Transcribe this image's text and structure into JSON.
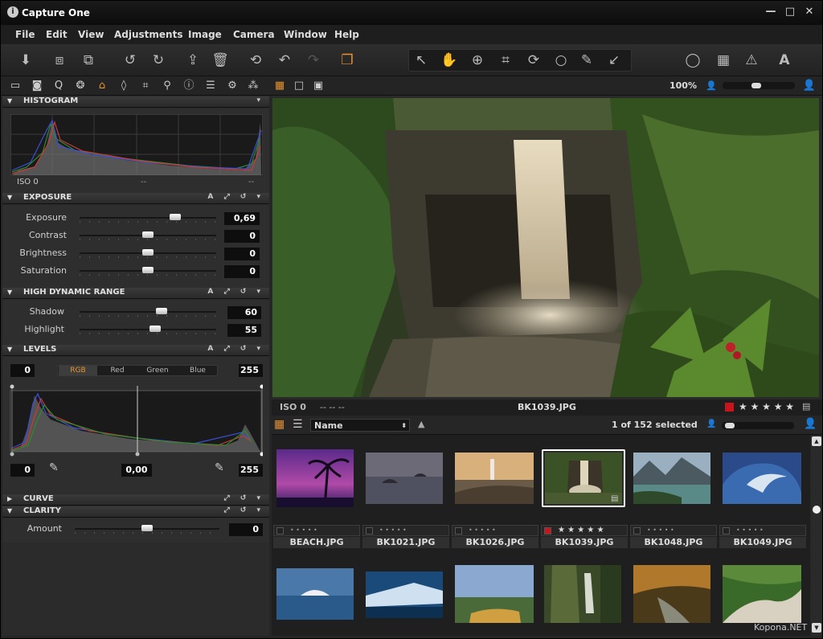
{
  "app": {
    "title": "Capture One"
  },
  "window_controls": {
    "minimize": "—",
    "maximize": "□",
    "close": "✕"
  },
  "menu": [
    "File",
    "Edit",
    "View",
    "Adjustments",
    "Image",
    "Camera",
    "Window",
    "Help"
  ],
  "toolbar": {
    "icons": [
      "import-icon",
      "capture-left-icon",
      "capture-right-icon",
      "rotate-left-icon",
      "rotate-right-icon",
      "move-to-folder-icon",
      "trash-icon",
      "undo-icon",
      "undo-single-icon",
      "redo-icon",
      "copy-adjustments-icon",
      "select-icon",
      "pan-icon",
      "zoom-icon",
      "crop-icon",
      "rotate-icon",
      "spot-icon",
      "color-picker-icon",
      "apply-icon",
      "loupe-icon",
      "grid-icon",
      "exposure-warning-icon",
      "text-icon"
    ]
  },
  "viewer_controls": {
    "zoom": "100%"
  },
  "histogram": {
    "title": "HISTOGRAM",
    "iso": "ISO 0",
    "meta1": "--",
    "meta2": "--"
  },
  "exposure": {
    "title": "EXPOSURE",
    "rows": [
      {
        "label": "Exposure",
        "value": "0,69",
        "level": 0.7
      },
      {
        "label": "Contrast",
        "value": "0",
        "level": 0.5
      },
      {
        "label": "Brightness",
        "value": "0",
        "level": 0.5
      },
      {
        "label": "Saturation",
        "value": "0",
        "level": 0.5
      }
    ]
  },
  "hdr": {
    "title": "HIGH DYNAMIC RANGE",
    "rows": [
      {
        "label": "Shadow",
        "value": "60",
        "level": 0.6
      },
      {
        "label": "Highlight",
        "value": "55",
        "level": 0.55
      }
    ]
  },
  "levels": {
    "title": "LEVELS",
    "in_low": "0",
    "in_high": "255",
    "channels": [
      "RGB",
      "Red",
      "Green",
      "Blue"
    ],
    "active_channel": "RGB",
    "out_low": "0",
    "mid": "0,00",
    "out_high": "255"
  },
  "curve": {
    "title": "CURVE"
  },
  "clarity": {
    "title": "CLARITY",
    "rows": [
      {
        "label": "Amount",
        "value": "0",
        "level": 0.5
      }
    ]
  },
  "viewer": {
    "iso": "ISO 0",
    "meta": "--  --  --",
    "filename": "BK1039.JPG",
    "rating": "★ ★ ★ ★ ★"
  },
  "browser": {
    "sort_label": "Name",
    "selection": "1 of 152 selected",
    "thumbs_row1": [
      {
        "name": "BEACH.JPG",
        "rated": false
      },
      {
        "name": "BK1021.JPG",
        "rated": false
      },
      {
        "name": "BK1026.JPG",
        "rated": false
      },
      {
        "name": "BK1039.JPG",
        "rated": true
      },
      {
        "name": "BK1048.JPG",
        "rated": false
      },
      {
        "name": "BK1049.JPG",
        "rated": false
      }
    ],
    "dots": "•  •  •  •  •",
    "stars": "★  ★  ★  ★  ★"
  },
  "watermark": "Kopona.NET",
  "colors": {
    "accent": "#e7922e",
    "panel": "#2b2b2b",
    "selected": "#ffffff",
    "label_red": "#c8141b"
  }
}
